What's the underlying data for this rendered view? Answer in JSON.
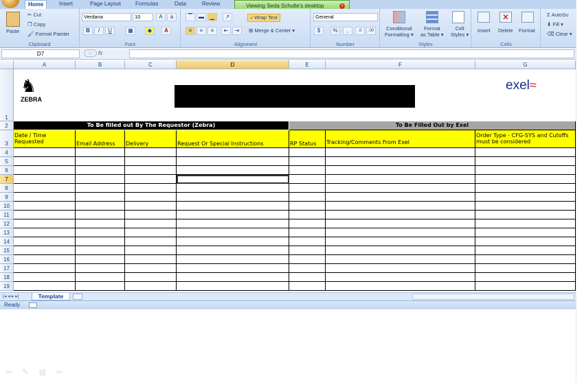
{
  "ribbon_tabs": [
    "Home",
    "Insert",
    "Page Layout",
    "Formulas",
    "Data",
    "Review"
  ],
  "notification": "Viewing Seda Schulte's desktop",
  "clipboard": {
    "cut": "Cut",
    "copy": "Copy",
    "format_painter": "Format Painter",
    "paste": "Paste",
    "group": "Clipboard"
  },
  "font": {
    "name": "Verdana",
    "size": "10",
    "bold": "B",
    "italic": "I",
    "underline": "U",
    "group": "Font"
  },
  "alignment": {
    "wrap_text": "Wrap Text",
    "merge_center": "Merge & Center",
    "group": "Alignment"
  },
  "number": {
    "format": "General",
    "currency": "$",
    "percent": "%",
    "comma": ",",
    "group": "Number"
  },
  "styles": {
    "conditional": "Conditional",
    "conditional2": "Formatting",
    "format_table": "Format",
    "format_table2": "as Table",
    "cell_styles": "Cell",
    "cell_styles2": "Styles",
    "group": "Styles"
  },
  "cells": {
    "insert": "Insert",
    "delete": "Delete",
    "format": "Format",
    "group": "Cells"
  },
  "editing": {
    "autosum": "AutoSu",
    "fill": "Fill",
    "clear": "Clear"
  },
  "name_box": "D7",
  "fx": "fx",
  "columns": [
    "A",
    "B",
    "C",
    "D",
    "E",
    "F",
    "G"
  ],
  "rows": [
    "1",
    "2",
    "3",
    "4",
    "5",
    "6",
    "7",
    "8",
    "9",
    "10",
    "11",
    "12",
    "13",
    "14",
    "15",
    "16",
    "17",
    "18",
    "19"
  ],
  "logos": {
    "zebra": "ZEBRA",
    "exel": "exel"
  },
  "row2": {
    "left": "To Be filled out By The Requestor (Zebra)",
    "right": "To Be Filled Out by Exel"
  },
  "headers": [
    "Date / Time Requested",
    "Email Address",
    "Delivery",
    "Request Or Special Instructions",
    "RP Status",
    "Tracking/Comments From Exel",
    "Order Type - CFG-SYS and Cutoffs must be considered"
  ],
  "sheet_tab": "Template",
  "status": "Ready",
  "colors": {
    "yellow": "#ffff00",
    "black": "#000000",
    "gray": "#a6a6a6",
    "selected_header": "#f2c866"
  }
}
